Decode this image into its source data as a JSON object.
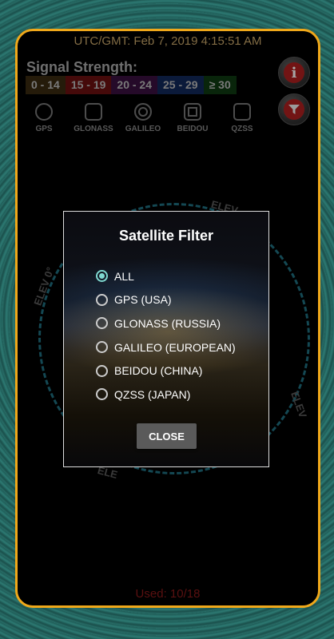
{
  "header": {
    "utc": "UTC/GMT: Feb 7, 2019 4:15:51 AM"
  },
  "signal": {
    "title": "Signal Strength:",
    "ranges": [
      {
        "label": "0 - 14",
        "color": "#3a2a10"
      },
      {
        "label": "15 - 19",
        "color": "#6a1010"
      },
      {
        "label": "20 - 24",
        "color": "#3a1040"
      },
      {
        "label": "25 - 29",
        "color": "#12285a"
      },
      {
        "label": "≥ 30",
        "color": "#0f3a12"
      }
    ]
  },
  "constellations": [
    {
      "label": "GPS",
      "symbol": "circle"
    },
    {
      "label": "GLONASS",
      "symbol": "square"
    },
    {
      "label": "GALILEO",
      "symbol": "double-circle"
    },
    {
      "label": "BEIDOU",
      "symbol": "double-square"
    },
    {
      "label": "QZSS",
      "symbol": "square-yellow"
    }
  ],
  "radar": {
    "elev_labels": [
      "ELEV",
      "ELEV 0°",
      "ELEV",
      "ELE"
    ]
  },
  "footer": {
    "used": "Used: 10/18"
  },
  "dialog": {
    "title": "Satellite Filter",
    "options": [
      {
        "label": "ALL",
        "selected": true
      },
      {
        "label": "GPS (USA)",
        "selected": false
      },
      {
        "label": "GLONASS (RUSSIA)",
        "selected": false
      },
      {
        "label": "GALILEO (EUROPEAN)",
        "selected": false
      },
      {
        "label": "BEIDOU (CHINA)",
        "selected": false
      },
      {
        "label": "QZSS (JAPAN)",
        "selected": false
      }
    ],
    "close_label": "CLOSE"
  },
  "icons": {
    "info": "info-icon",
    "filter": "filter-icon"
  }
}
